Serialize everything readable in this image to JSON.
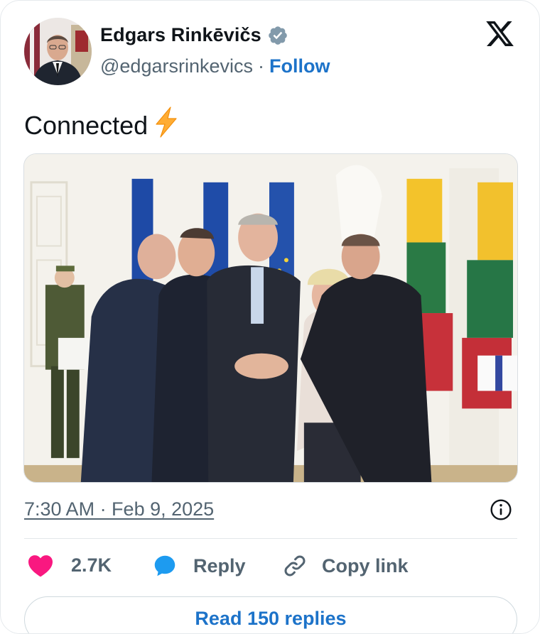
{
  "author": {
    "name": "Edgars Rinkēvičs",
    "handle": "@edgarsrinkevics",
    "separator": "·",
    "follow_label": "Follow"
  },
  "icons": {
    "verified": "verified-badge-icon",
    "brand": "x-logo-icon",
    "emoji": "high-voltage-emoji",
    "info": "info-icon",
    "like": "heart-icon",
    "reply": "speech-bubble-icon",
    "copy": "link-icon"
  },
  "tweet": {
    "text": "Connected",
    "emoji": "⚡",
    "timestamp": "7:30 AM · Feb 9, 2025"
  },
  "actions": {
    "like_count": "2.7K",
    "reply_label": "Reply",
    "copy_label": "Copy link"
  },
  "read_replies_label": "Read 150 replies",
  "colors": {
    "link": "#1d73c9",
    "secondary_text": "#536471",
    "like": "#f91880",
    "reply": "#1d9bf0",
    "verified": "#829aab"
  }
}
